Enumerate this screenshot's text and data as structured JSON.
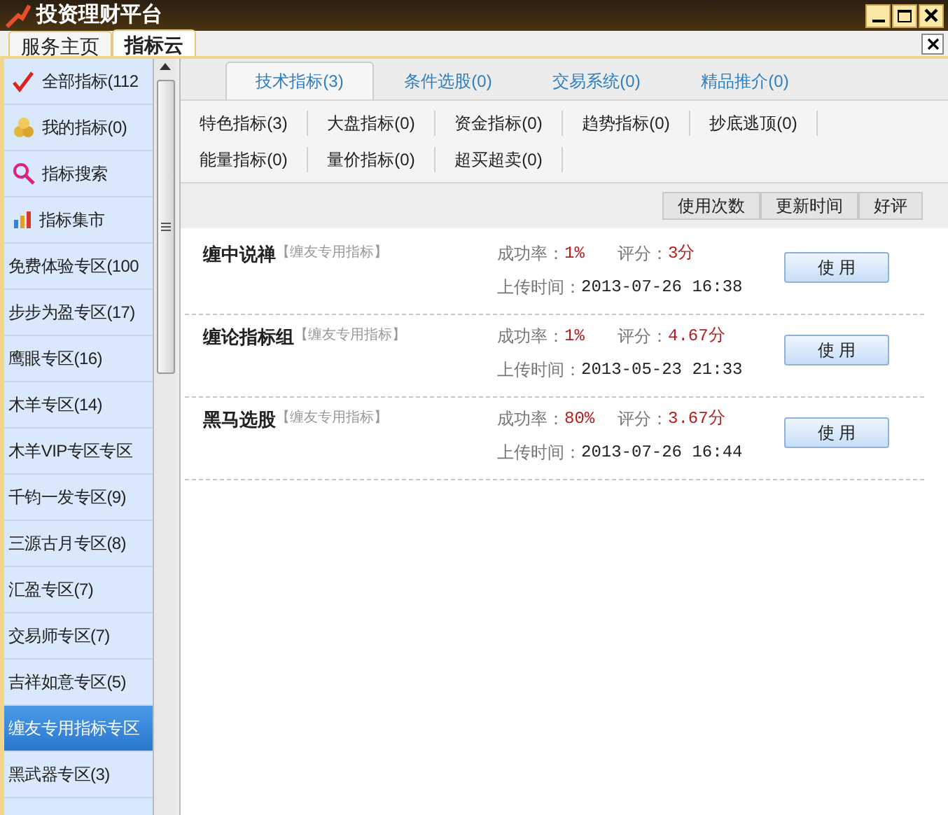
{
  "window": {
    "title": "投资理财平台"
  },
  "tabs": [
    {
      "label": "服务主页",
      "selected": false
    },
    {
      "label": "指标云",
      "selected": true
    }
  ],
  "sidebar": {
    "items": [
      {
        "label": "全部指标(112",
        "kind": "chart",
        "selected": false
      },
      {
        "label": "我的指标(0)",
        "kind": "coins",
        "selected": false
      },
      {
        "label": "指标搜索",
        "kind": "search",
        "selected": false
      },
      {
        "label": "指标集市",
        "kind": "bars",
        "selected": false
      },
      {
        "label": "免费体验专区(100",
        "kind": "text",
        "selected": false
      },
      {
        "label": "步步为盈专区(17)",
        "kind": "text",
        "selected": false
      },
      {
        "label": "鹰眼专区(16)",
        "kind": "text",
        "selected": false
      },
      {
        "label": "木羊专区(14)",
        "kind": "text",
        "selected": false
      },
      {
        "label": "木羊VIP专区专区",
        "kind": "text",
        "selected": false
      },
      {
        "label": "千钧一发专区(9)",
        "kind": "text",
        "selected": false
      },
      {
        "label": "三源古月专区(8)",
        "kind": "text",
        "selected": false
      },
      {
        "label": "汇盈专区(7)",
        "kind": "text",
        "selected": false
      },
      {
        "label": "交易师专区(7)",
        "kind": "text",
        "selected": false
      },
      {
        "label": "吉祥如意专区(5)",
        "kind": "text",
        "selected": false
      },
      {
        "label": "缠友专用指标专区",
        "kind": "text",
        "selected": true
      },
      {
        "label": "黑武器专区(3)",
        "kind": "text",
        "selected": false
      }
    ]
  },
  "content_tabs": [
    {
      "label": "技术指标(3)",
      "selected": true
    },
    {
      "label": "条件选股(0)",
      "selected": false
    },
    {
      "label": "交易系统(0)",
      "selected": false
    },
    {
      "label": "精品推介(0)",
      "selected": false
    }
  ],
  "categories": [
    [
      "特色指标(3)",
      "大盘指标(0)",
      "资金指标(0)",
      "趋势指标(0)",
      "抄底逃顶(0)"
    ],
    [
      "能量指标(0)",
      "量价指标(0)",
      "超买超卖(0)"
    ]
  ],
  "sort_buttons": [
    "使用次数",
    "更新时间",
    "好评"
  ],
  "indicators": [
    {
      "name": "缠中说禅",
      "tag": "【缠友专用指标】",
      "rate_label": "成功率：",
      "rate": "1%",
      "score_label": "评分：",
      "score": "3分",
      "time_label": "上传时间：",
      "time": "2013-07-26 16:38",
      "button": "使 用"
    },
    {
      "name": "缠论指标组",
      "tag": "【缠友专用指标】",
      "rate_label": "成功率：",
      "rate": "1%",
      "score_label": "评分：",
      "score": "4.67分",
      "time_label": "上传时间：",
      "time": "2013-05-23 21:33",
      "button": "使 用"
    },
    {
      "name": "黑马选股",
      "tag": "【缠友专用指标】",
      "rate_label": "成功率：",
      "rate": "80%",
      "score_label": "评分：",
      "score": "3.67分",
      "time_label": "上传时间：",
      "time": "2013-07-26 16:44",
      "button": "使 用"
    }
  ]
}
